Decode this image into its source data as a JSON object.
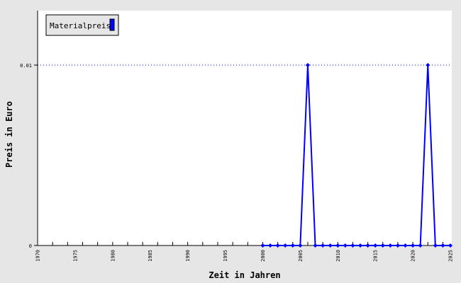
{
  "chart_data": {
    "type": "line",
    "title": "",
    "xlabel": "Zeit in Jahren",
    "ylabel": "Preis in Euro",
    "xlim": [
      1970,
      2025
    ],
    "ylim": [
      0,
      0.012
    ],
    "y_ticks": [
      {
        "value": 0,
        "label": "0"
      },
      {
        "value": 0.01,
        "label": "0.01"
      }
    ],
    "x_tick_labels": [
      {
        "value": 1970,
        "label": "1970"
      },
      {
        "value": 1975,
        "label": "1975"
      },
      {
        "value": 1980,
        "label": "1980"
      },
      {
        "value": 1985,
        "label": "1985"
      },
      {
        "value": 1990,
        "label": "1990"
      },
      {
        "value": 1995,
        "label": "1995"
      },
      {
        "value": 2000,
        "label": "2000"
      },
      {
        "value": 2005,
        "label": "2005"
      },
      {
        "value": 2010,
        "label": "2010"
      },
      {
        "value": 2015,
        "label": "2015"
      },
      {
        "value": 2020,
        "label": "2020"
      },
      {
        "value": 2025,
        "label": "2025"
      }
    ],
    "x_minor_tick_step": 2,
    "grid": "horizontal dotted at 0.01",
    "legend": {
      "placement": "top-left",
      "entries": [
        {
          "label": "Materialpreis",
          "color": "#0000ff"
        }
      ]
    },
    "series": [
      {
        "name": "Materialpreis",
        "color": "#0000ff",
        "points": [
          [
            2000,
            0
          ],
          [
            2001,
            0
          ],
          [
            2002,
            0
          ],
          [
            2003,
            0
          ],
          [
            2004,
            0
          ],
          [
            2005,
            0
          ],
          [
            2006,
            0.01
          ],
          [
            2007,
            0
          ],
          [
            2008,
            0
          ],
          [
            2009,
            0
          ],
          [
            2010,
            0
          ],
          [
            2011,
            0
          ],
          [
            2012,
            0
          ],
          [
            2013,
            0
          ],
          [
            2014,
            0
          ],
          [
            2015,
            0
          ],
          [
            2016,
            0
          ],
          [
            2017,
            0
          ],
          [
            2018,
            0
          ],
          [
            2019,
            0
          ],
          [
            2020,
            0
          ],
          [
            2021,
            0
          ],
          [
            2022,
            0.01
          ],
          [
            2023,
            0
          ],
          [
            2024,
            0
          ],
          [
            2025,
            0
          ]
        ]
      }
    ]
  }
}
